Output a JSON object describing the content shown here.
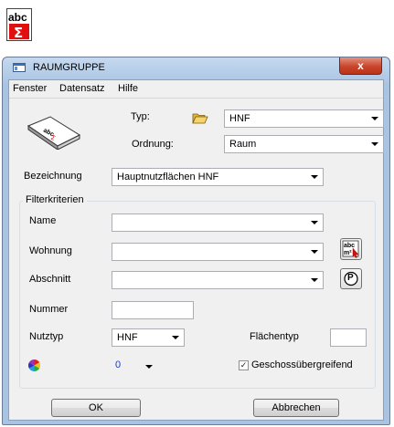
{
  "window": {
    "title": "RAUMGRUPPE",
    "close_glyph": "x"
  },
  "menu": [
    "Fenster",
    "Datensatz",
    "Hilfe"
  ],
  "form": {
    "typ_label": "Typ:",
    "typ_value": "HNF",
    "ordnung_label": "Ordnung:",
    "ordnung_value": "Raum",
    "bezeichnung_label": "Bezeichnung",
    "bezeichnung_value": "Hauptnutzflächen HNF"
  },
  "filter": {
    "title": "Filterkriterien",
    "name_label": "Name",
    "name_value": "",
    "wohnung_label": "Wohnung",
    "wohnung_value": "",
    "abschnitt_label": "Abschnitt",
    "abschnitt_value": "",
    "nummer_label": "Nummer",
    "nummer_value": "",
    "nutztyp_label": "Nutztyp",
    "nutztyp_value": "HNF",
    "flaechentyp_label": "Flächentyp",
    "flaechentyp_value": "",
    "color_value": "0",
    "geschoss_label": "Geschossübergreifend",
    "geschoss_checked": true,
    "p_glyph": "P"
  },
  "buttons": {
    "ok": "OK",
    "cancel": "Abbrechen"
  },
  "colors": {
    "color_link": "#1a3cc8",
    "title_gradient": "#a9c4e3",
    "close_red": "#c8452c"
  },
  "icons": [
    "abc-sigma-app-icon",
    "window-icon",
    "folder-open-icon",
    "abc-book-icon",
    "abc-m2-cursor-icon",
    "p-circle-icon",
    "color-wheel-icon",
    "close-icon",
    "dropdown-arrow-icon"
  ]
}
